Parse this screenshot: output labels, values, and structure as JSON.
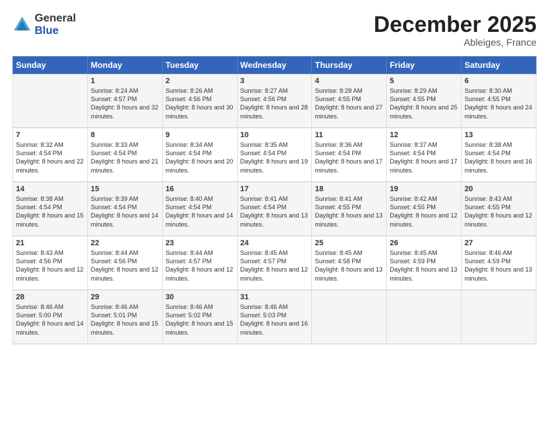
{
  "logo": {
    "general": "General",
    "blue": "Blue"
  },
  "title": "December 2025",
  "location": "Ableiges, France",
  "days_header": [
    "Sunday",
    "Monday",
    "Tuesday",
    "Wednesday",
    "Thursday",
    "Friday",
    "Saturday"
  ],
  "weeks": [
    [
      {
        "day": "",
        "sunrise": "",
        "sunset": "",
        "daylight": ""
      },
      {
        "day": "1",
        "sunrise": "Sunrise: 8:24 AM",
        "sunset": "Sunset: 4:57 PM",
        "daylight": "Daylight: 8 hours and 32 minutes."
      },
      {
        "day": "2",
        "sunrise": "Sunrise: 8:26 AM",
        "sunset": "Sunset: 4:56 PM",
        "daylight": "Daylight: 8 hours and 30 minutes."
      },
      {
        "day": "3",
        "sunrise": "Sunrise: 8:27 AM",
        "sunset": "Sunset: 4:56 PM",
        "daylight": "Daylight: 8 hours and 28 minutes."
      },
      {
        "day": "4",
        "sunrise": "Sunrise: 8:28 AM",
        "sunset": "Sunset: 4:55 PM",
        "daylight": "Daylight: 8 hours and 27 minutes."
      },
      {
        "day": "5",
        "sunrise": "Sunrise: 8:29 AM",
        "sunset": "Sunset: 4:55 PM",
        "daylight": "Daylight: 8 hours and 25 minutes."
      },
      {
        "day": "6",
        "sunrise": "Sunrise: 8:30 AM",
        "sunset": "Sunset: 4:55 PM",
        "daylight": "Daylight: 8 hours and 24 minutes."
      }
    ],
    [
      {
        "day": "7",
        "sunrise": "Sunrise: 8:32 AM",
        "sunset": "Sunset: 4:54 PM",
        "daylight": "Daylight: 8 hours and 22 minutes."
      },
      {
        "day": "8",
        "sunrise": "Sunrise: 8:33 AM",
        "sunset": "Sunset: 4:54 PM",
        "daylight": "Daylight: 8 hours and 21 minutes."
      },
      {
        "day": "9",
        "sunrise": "Sunrise: 8:34 AM",
        "sunset": "Sunset: 4:54 PM",
        "daylight": "Daylight: 8 hours and 20 minutes."
      },
      {
        "day": "10",
        "sunrise": "Sunrise: 8:35 AM",
        "sunset": "Sunset: 4:54 PM",
        "daylight": "Daylight: 8 hours and 19 minutes."
      },
      {
        "day": "11",
        "sunrise": "Sunrise: 8:36 AM",
        "sunset": "Sunset: 4:54 PM",
        "daylight": "Daylight: 8 hours and 17 minutes."
      },
      {
        "day": "12",
        "sunrise": "Sunrise: 8:37 AM",
        "sunset": "Sunset: 4:54 PM",
        "daylight": "Daylight: 8 hours and 17 minutes."
      },
      {
        "day": "13",
        "sunrise": "Sunrise: 8:38 AM",
        "sunset": "Sunset: 4:54 PM",
        "daylight": "Daylight: 8 hours and 16 minutes."
      }
    ],
    [
      {
        "day": "14",
        "sunrise": "Sunrise: 8:38 AM",
        "sunset": "Sunset: 4:54 PM",
        "daylight": "Daylight: 8 hours and 15 minutes."
      },
      {
        "day": "15",
        "sunrise": "Sunrise: 8:39 AM",
        "sunset": "Sunset: 4:54 PM",
        "daylight": "Daylight: 8 hours and 14 minutes."
      },
      {
        "day": "16",
        "sunrise": "Sunrise: 8:40 AM",
        "sunset": "Sunset: 4:54 PM",
        "daylight": "Daylight: 8 hours and 14 minutes."
      },
      {
        "day": "17",
        "sunrise": "Sunrise: 8:41 AM",
        "sunset": "Sunset: 4:54 PM",
        "daylight": "Daylight: 8 hours and 13 minutes."
      },
      {
        "day": "18",
        "sunrise": "Sunrise: 8:41 AM",
        "sunset": "Sunset: 4:55 PM",
        "daylight": "Daylight: 8 hours and 13 minutes."
      },
      {
        "day": "19",
        "sunrise": "Sunrise: 8:42 AM",
        "sunset": "Sunset: 4:55 PM",
        "daylight": "Daylight: 8 hours and 12 minutes."
      },
      {
        "day": "20",
        "sunrise": "Sunrise: 8:43 AM",
        "sunset": "Sunset: 4:55 PM",
        "daylight": "Daylight: 8 hours and 12 minutes."
      }
    ],
    [
      {
        "day": "21",
        "sunrise": "Sunrise: 8:43 AM",
        "sunset": "Sunset: 4:56 PM",
        "daylight": "Daylight: 8 hours and 12 minutes."
      },
      {
        "day": "22",
        "sunrise": "Sunrise: 8:44 AM",
        "sunset": "Sunset: 4:56 PM",
        "daylight": "Daylight: 8 hours and 12 minutes."
      },
      {
        "day": "23",
        "sunrise": "Sunrise: 8:44 AM",
        "sunset": "Sunset: 4:57 PM",
        "daylight": "Daylight: 8 hours and 12 minutes."
      },
      {
        "day": "24",
        "sunrise": "Sunrise: 8:45 AM",
        "sunset": "Sunset: 4:57 PM",
        "daylight": "Daylight: 8 hours and 12 minutes."
      },
      {
        "day": "25",
        "sunrise": "Sunrise: 8:45 AM",
        "sunset": "Sunset: 4:58 PM",
        "daylight": "Daylight: 8 hours and 13 minutes."
      },
      {
        "day": "26",
        "sunrise": "Sunrise: 8:45 AM",
        "sunset": "Sunset: 4:59 PM",
        "daylight": "Daylight: 8 hours and 13 minutes."
      },
      {
        "day": "27",
        "sunrise": "Sunrise: 8:46 AM",
        "sunset": "Sunset: 4:59 PM",
        "daylight": "Daylight: 8 hours and 13 minutes."
      }
    ],
    [
      {
        "day": "28",
        "sunrise": "Sunrise: 8:46 AM",
        "sunset": "Sunset: 5:00 PM",
        "daylight": "Daylight: 8 hours and 14 minutes."
      },
      {
        "day": "29",
        "sunrise": "Sunrise: 8:46 AM",
        "sunset": "Sunset: 5:01 PM",
        "daylight": "Daylight: 8 hours and 15 minutes."
      },
      {
        "day": "30",
        "sunrise": "Sunrise: 8:46 AM",
        "sunset": "Sunset: 5:02 PM",
        "daylight": "Daylight: 8 hours and 15 minutes."
      },
      {
        "day": "31",
        "sunrise": "Sunrise: 8:46 AM",
        "sunset": "Sunset: 5:03 PM",
        "daylight": "Daylight: 8 hours and 16 minutes."
      },
      {
        "day": "",
        "sunrise": "",
        "sunset": "",
        "daylight": ""
      },
      {
        "day": "",
        "sunrise": "",
        "sunset": "",
        "daylight": ""
      },
      {
        "day": "",
        "sunrise": "",
        "sunset": "",
        "daylight": ""
      }
    ]
  ]
}
